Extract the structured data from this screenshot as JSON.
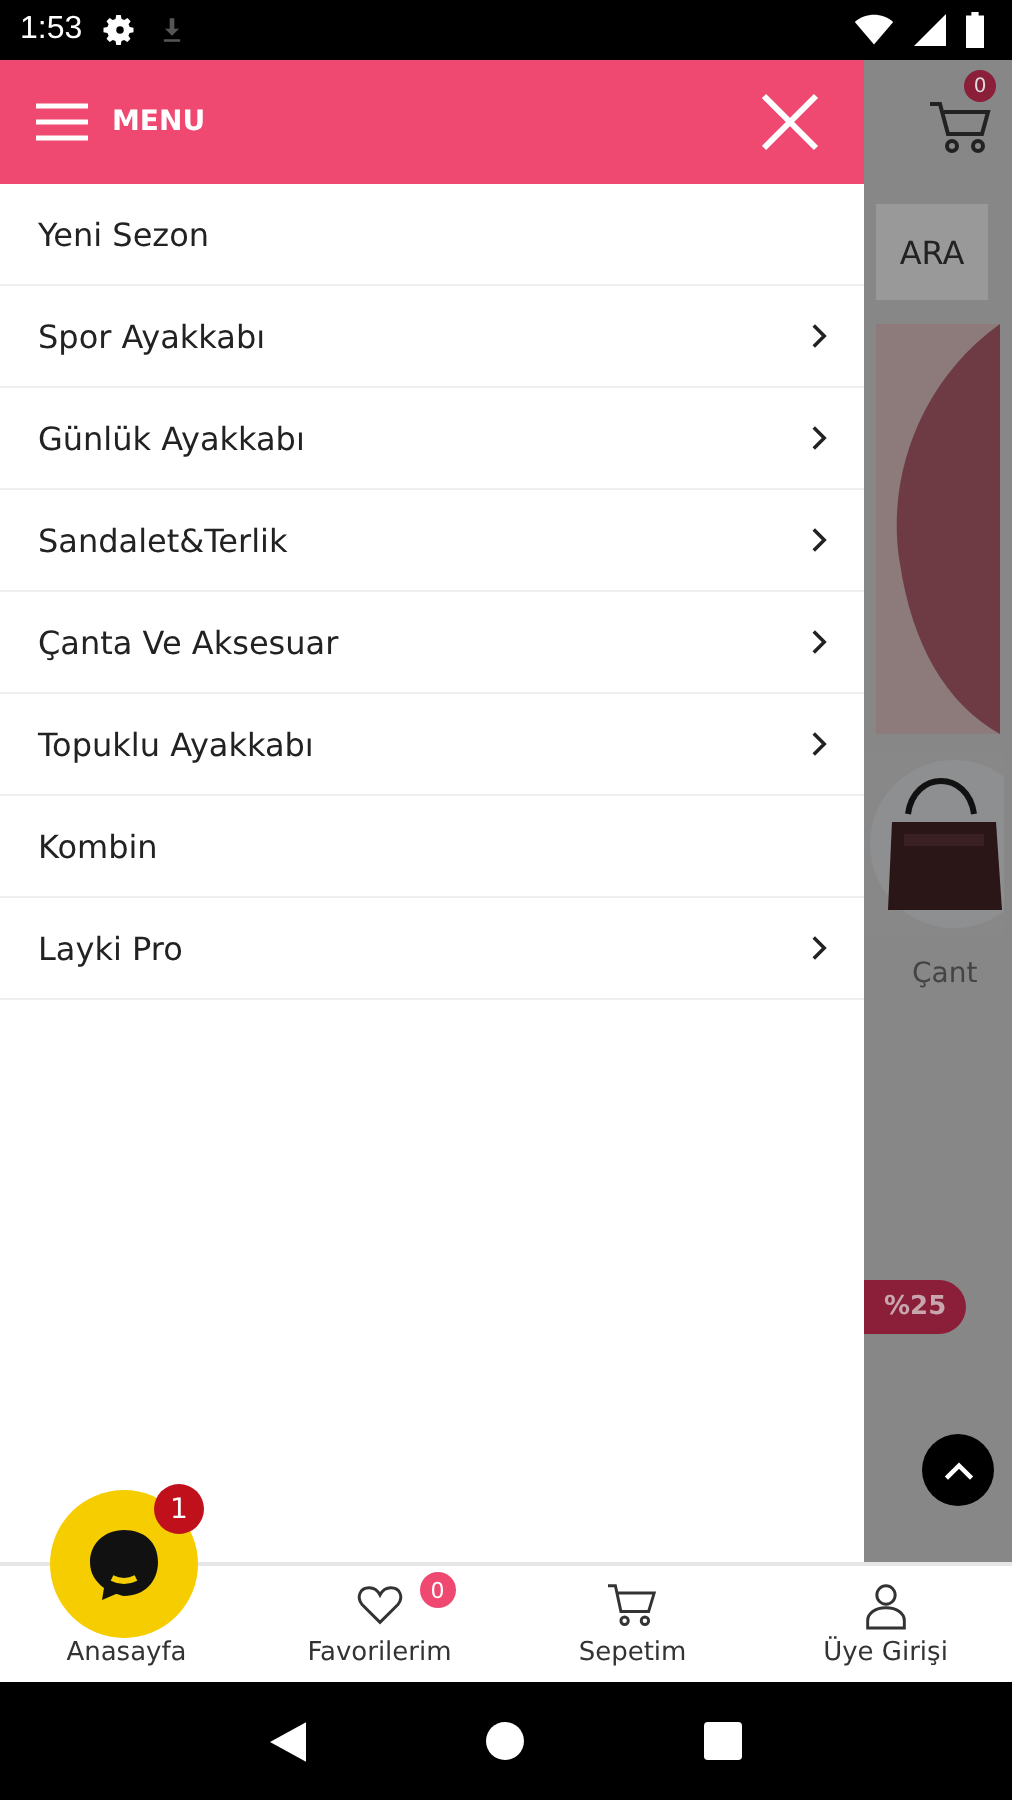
{
  "status_bar": {
    "time": "1:53"
  },
  "drawer": {
    "title": "MENU",
    "items": [
      {
        "label": "Yeni Sezon",
        "has_submenu": false
      },
      {
        "label": "Spor Ayakkabı",
        "has_submenu": true
      },
      {
        "label": "Günlük Ayakkabı",
        "has_submenu": true
      },
      {
        "label": "Sandalet&Terlik",
        "has_submenu": true
      },
      {
        "label": "Çanta Ve Aksesuar",
        "has_submenu": true
      },
      {
        "label": "Topuklu Ayakkabı",
        "has_submenu": true
      },
      {
        "label": "Kombin",
        "has_submenu": false
      },
      {
        "label": "Layki Pro",
        "has_submenu": true
      }
    ]
  },
  "background_page": {
    "cart_count": "0",
    "search_button": "ARA",
    "category_label": "Çant",
    "discount_tag": "%25"
  },
  "chat_button": {
    "badge": "1"
  },
  "bottom_nav": [
    {
      "label": "Anasayfa",
      "kind": "home"
    },
    {
      "label": "Favorilerim",
      "kind": "favorites",
      "badge": "0"
    },
    {
      "label": "Sepetim",
      "kind": "cart"
    },
    {
      "label": "Üye Girişi",
      "kind": "account"
    }
  ]
}
